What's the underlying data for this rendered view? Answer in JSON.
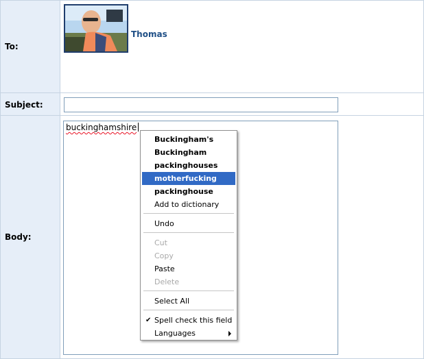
{
  "labels": {
    "to": "To:",
    "subject": "Subject:",
    "body": "Body:"
  },
  "recipient": {
    "name": "Thomas",
    "avatar_icon": "recipient-photo"
  },
  "subject": {
    "value": ""
  },
  "body": {
    "text": "buckinghamshire"
  },
  "context_menu": {
    "suggestions": [
      "Buckingham's",
      "Buckingham",
      "packinghouses",
      "motherfucking",
      "packinghouse"
    ],
    "add_to_dictionary": "Add to dictionary",
    "undo": "Undo",
    "cut": "Cut",
    "copy": "Copy",
    "paste": "Paste",
    "delete": "Delete",
    "select_all": "Select All",
    "spell_check": "Spell check this field",
    "languages": "Languages",
    "highlighted": "motherfucking",
    "spell_check_checked": true
  },
  "colors": {
    "label_background": "#e6eef8",
    "border": "#c5d3e2",
    "highlight": "#316ac5",
    "recipient_name": "#1f4f86"
  }
}
